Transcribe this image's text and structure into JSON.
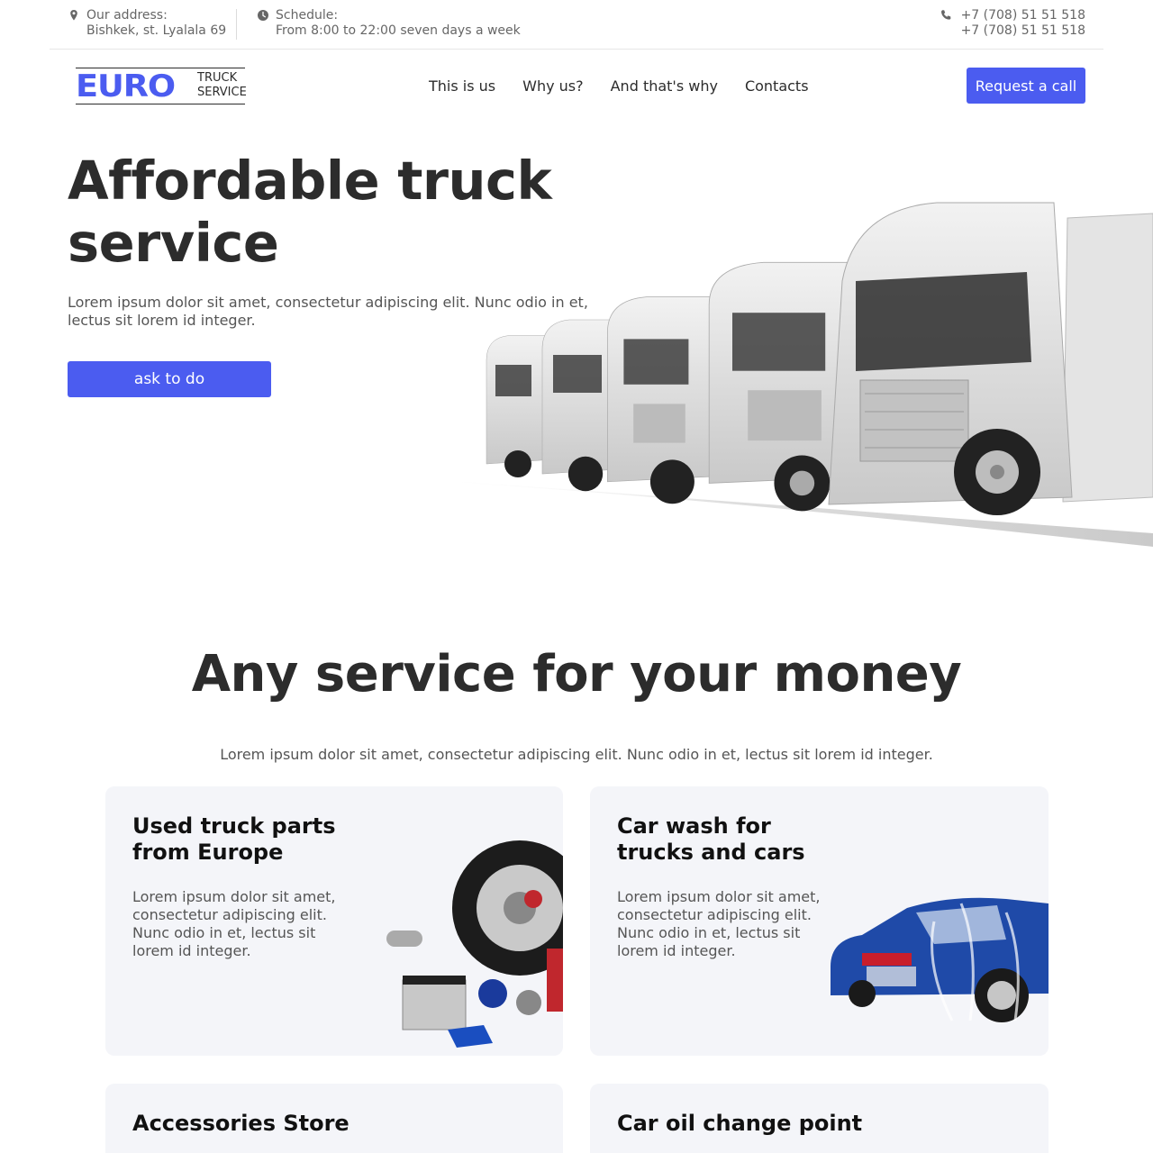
{
  "topbar": {
    "address_label": "Our address:",
    "address_value": "Bishkek, st. Lyalala 69",
    "address_icon": "map-pin-icon",
    "schedule_label": "Schedule:",
    "schedule_value": "From 8:00 to 22:00 seven days a week",
    "schedule_icon": "clock-icon",
    "phone_1": "+7 (708) 51 51 518",
    "phone_2": "+7 (708) 51 51 518",
    "phone_icon": "phone-icon"
  },
  "header": {
    "logo_main": "EURO",
    "logo_line1": "TRUCK",
    "logo_line2": "SERVICE",
    "nav": [
      "This is us",
      "Why us?",
      "And that's why",
      "Contacts"
    ],
    "cta_label": "Request a call"
  },
  "hero": {
    "title": "Affordable truck service",
    "text": "Lorem ipsum dolor sit amet, consectetur adipiscing elit. Nunc odio in et, lectus sit lorem id integer.",
    "button_label": "ask to do"
  },
  "services": {
    "title": "Any service for your money",
    "text": "Lorem ipsum dolor sit amet, consectetur adipiscing elit. Nunc odio in et, lectus sit lorem id integer.",
    "cards": [
      {
        "title": "Used truck parts from Europe",
        "text": "Lorem ipsum dolor sit amet, consectetur adipiscing elit. Nunc odio in et, lectus sit lorem id integer."
      },
      {
        "title": "Car wash for trucks and cars",
        "text": "Lorem ipsum dolor sit amet, consectetur adipiscing elit. Nunc odio in et, lectus sit lorem id integer."
      },
      {
        "title": "Accessories Store",
        "text": ""
      },
      {
        "title": "Car oil change point",
        "text": ""
      }
    ]
  },
  "colors": {
    "accent": "#4b5cf0",
    "text": "#2c2c2c",
    "muted": "#555555",
    "card_bg": "#f4f5f9"
  }
}
